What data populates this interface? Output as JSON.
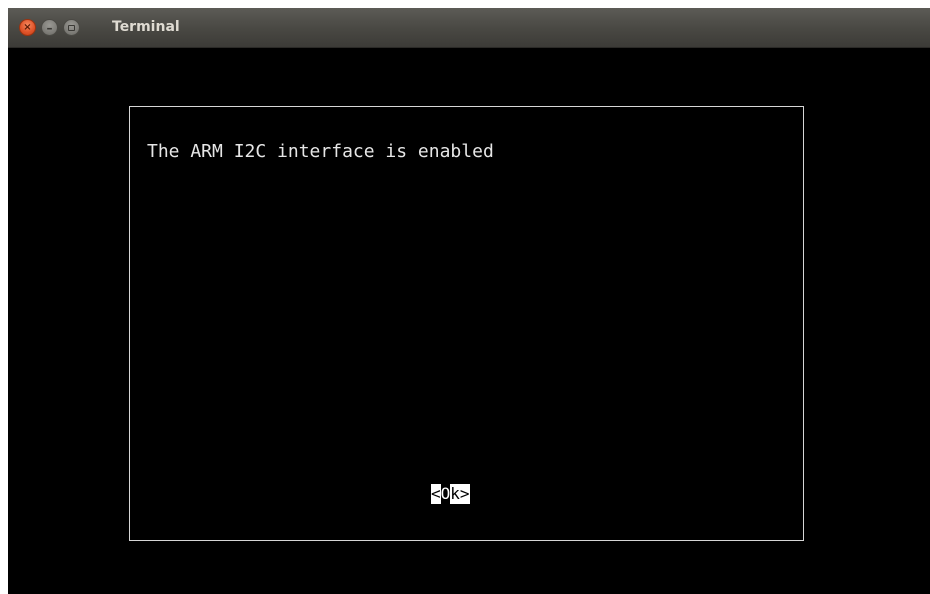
{
  "window": {
    "title": "Terminal",
    "controls": {
      "close_icon": "close-icon",
      "minimize_icon": "minimize-icon",
      "maximize_icon": "maximize-icon",
      "close_glyph": "×",
      "minimize_glyph": "–"
    }
  },
  "dialog": {
    "message": "The ARM I2C interface is enabled",
    "ok_button": {
      "left_bracket": "<",
      "hotkey": "O",
      "rest": "k",
      "right_bracket": ">"
    }
  },
  "colors": {
    "terminal_background": "#000000",
    "titlebar": "#3c3b37",
    "close_button": "#e0552b",
    "text": "#e6e6e6",
    "dialog_border": "#d6d6d6"
  }
}
